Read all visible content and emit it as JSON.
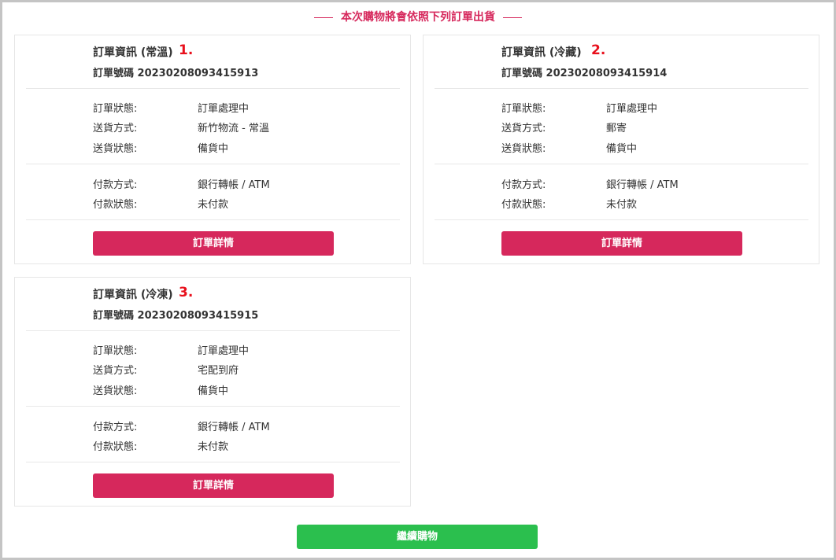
{
  "banner": {
    "text": "本次購物將會依照下列訂單出貨"
  },
  "orders": [
    {
      "title": "訂單資訊 (常溫)",
      "index": "1.",
      "order_no": "訂單號碼 20230208093415913",
      "status_label": "訂單狀態:",
      "status_value": "訂單處理中",
      "ship_method_label": "送貨方式:",
      "ship_method_value": "新竹物流 - 常溫",
      "ship_status_label": "送貨狀態:",
      "ship_status_value": "備貨中",
      "pay_method_label": "付款方式:",
      "pay_method_value": "銀行轉帳 / ATM",
      "pay_status_label": "付款狀態:",
      "pay_status_value": "未付款",
      "detail_button": "訂單詳情"
    },
    {
      "title": "訂單資訊 (冷藏)",
      "index": "2.",
      "order_no": "訂單號碼 20230208093415914",
      "status_label": "訂單狀態:",
      "status_value": "訂單處理中",
      "ship_method_label": "送貨方式:",
      "ship_method_value": "郵寄",
      "ship_status_label": "送貨狀態:",
      "ship_status_value": "備貨中",
      "pay_method_label": "付款方式:",
      "pay_method_value": "銀行轉帳 / ATM",
      "pay_status_label": "付款狀態:",
      "pay_status_value": "未付款",
      "detail_button": "訂單詳情"
    },
    {
      "title": "訂單資訊 (冷凍)",
      "index": "3.",
      "order_no": "訂單號碼 20230208093415915",
      "status_label": "訂單狀態:",
      "status_value": "訂單處理中",
      "ship_method_label": "送貨方式:",
      "ship_method_value": "宅配到府",
      "ship_status_label": "送貨狀態:",
      "ship_status_value": "備貨中",
      "pay_method_label": "付款方式:",
      "pay_method_value": "銀行轉帳 / ATM",
      "pay_status_label": "付款狀態:",
      "pay_status_value": "未付款",
      "detail_button": "訂單詳情"
    }
  ],
  "continue_button": "繼續購物",
  "colors": {
    "accent": "#d6285c",
    "continue": "#2bbf4e",
    "index": "#e8101c"
  }
}
